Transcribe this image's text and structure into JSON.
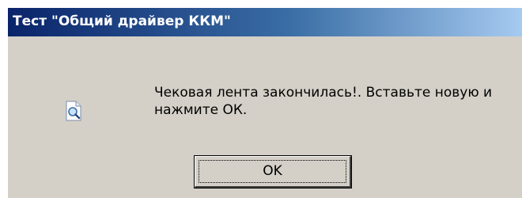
{
  "window": {
    "title": "Тест \"Общий драйвер ККМ\""
  },
  "message": {
    "icon": "document-magnifier-icon",
    "text": "Чековая лента закончилась!. Вставьте новую и нажмите ОК."
  },
  "buttons": {
    "ok_label": "OK"
  },
  "colors": {
    "titlebar_start": "#0a246a",
    "titlebar_end": "#a6caf0",
    "dialog_face": "#d4d0c8"
  }
}
